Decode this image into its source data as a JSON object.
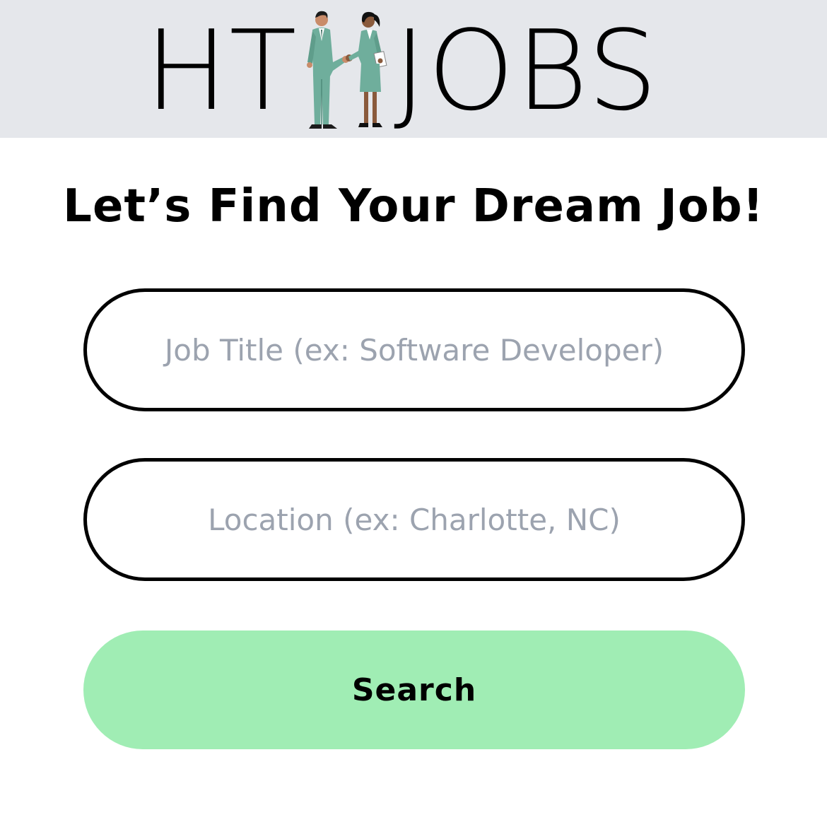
{
  "header": {
    "logo_left": "HT",
    "logo_right": "JOBS",
    "background_color": "#e5e7eb",
    "figures_icon": "handshake-people-icon"
  },
  "main": {
    "headline": "Let’s Find Your Dream Job!",
    "job_title_placeholder": "Job Title (ex: Software Developer)",
    "job_title_value": "",
    "location_placeholder": "Location (ex: Charlotte, NC)",
    "location_value": "",
    "search_label": "Search",
    "search_color": "#a0edb4"
  }
}
